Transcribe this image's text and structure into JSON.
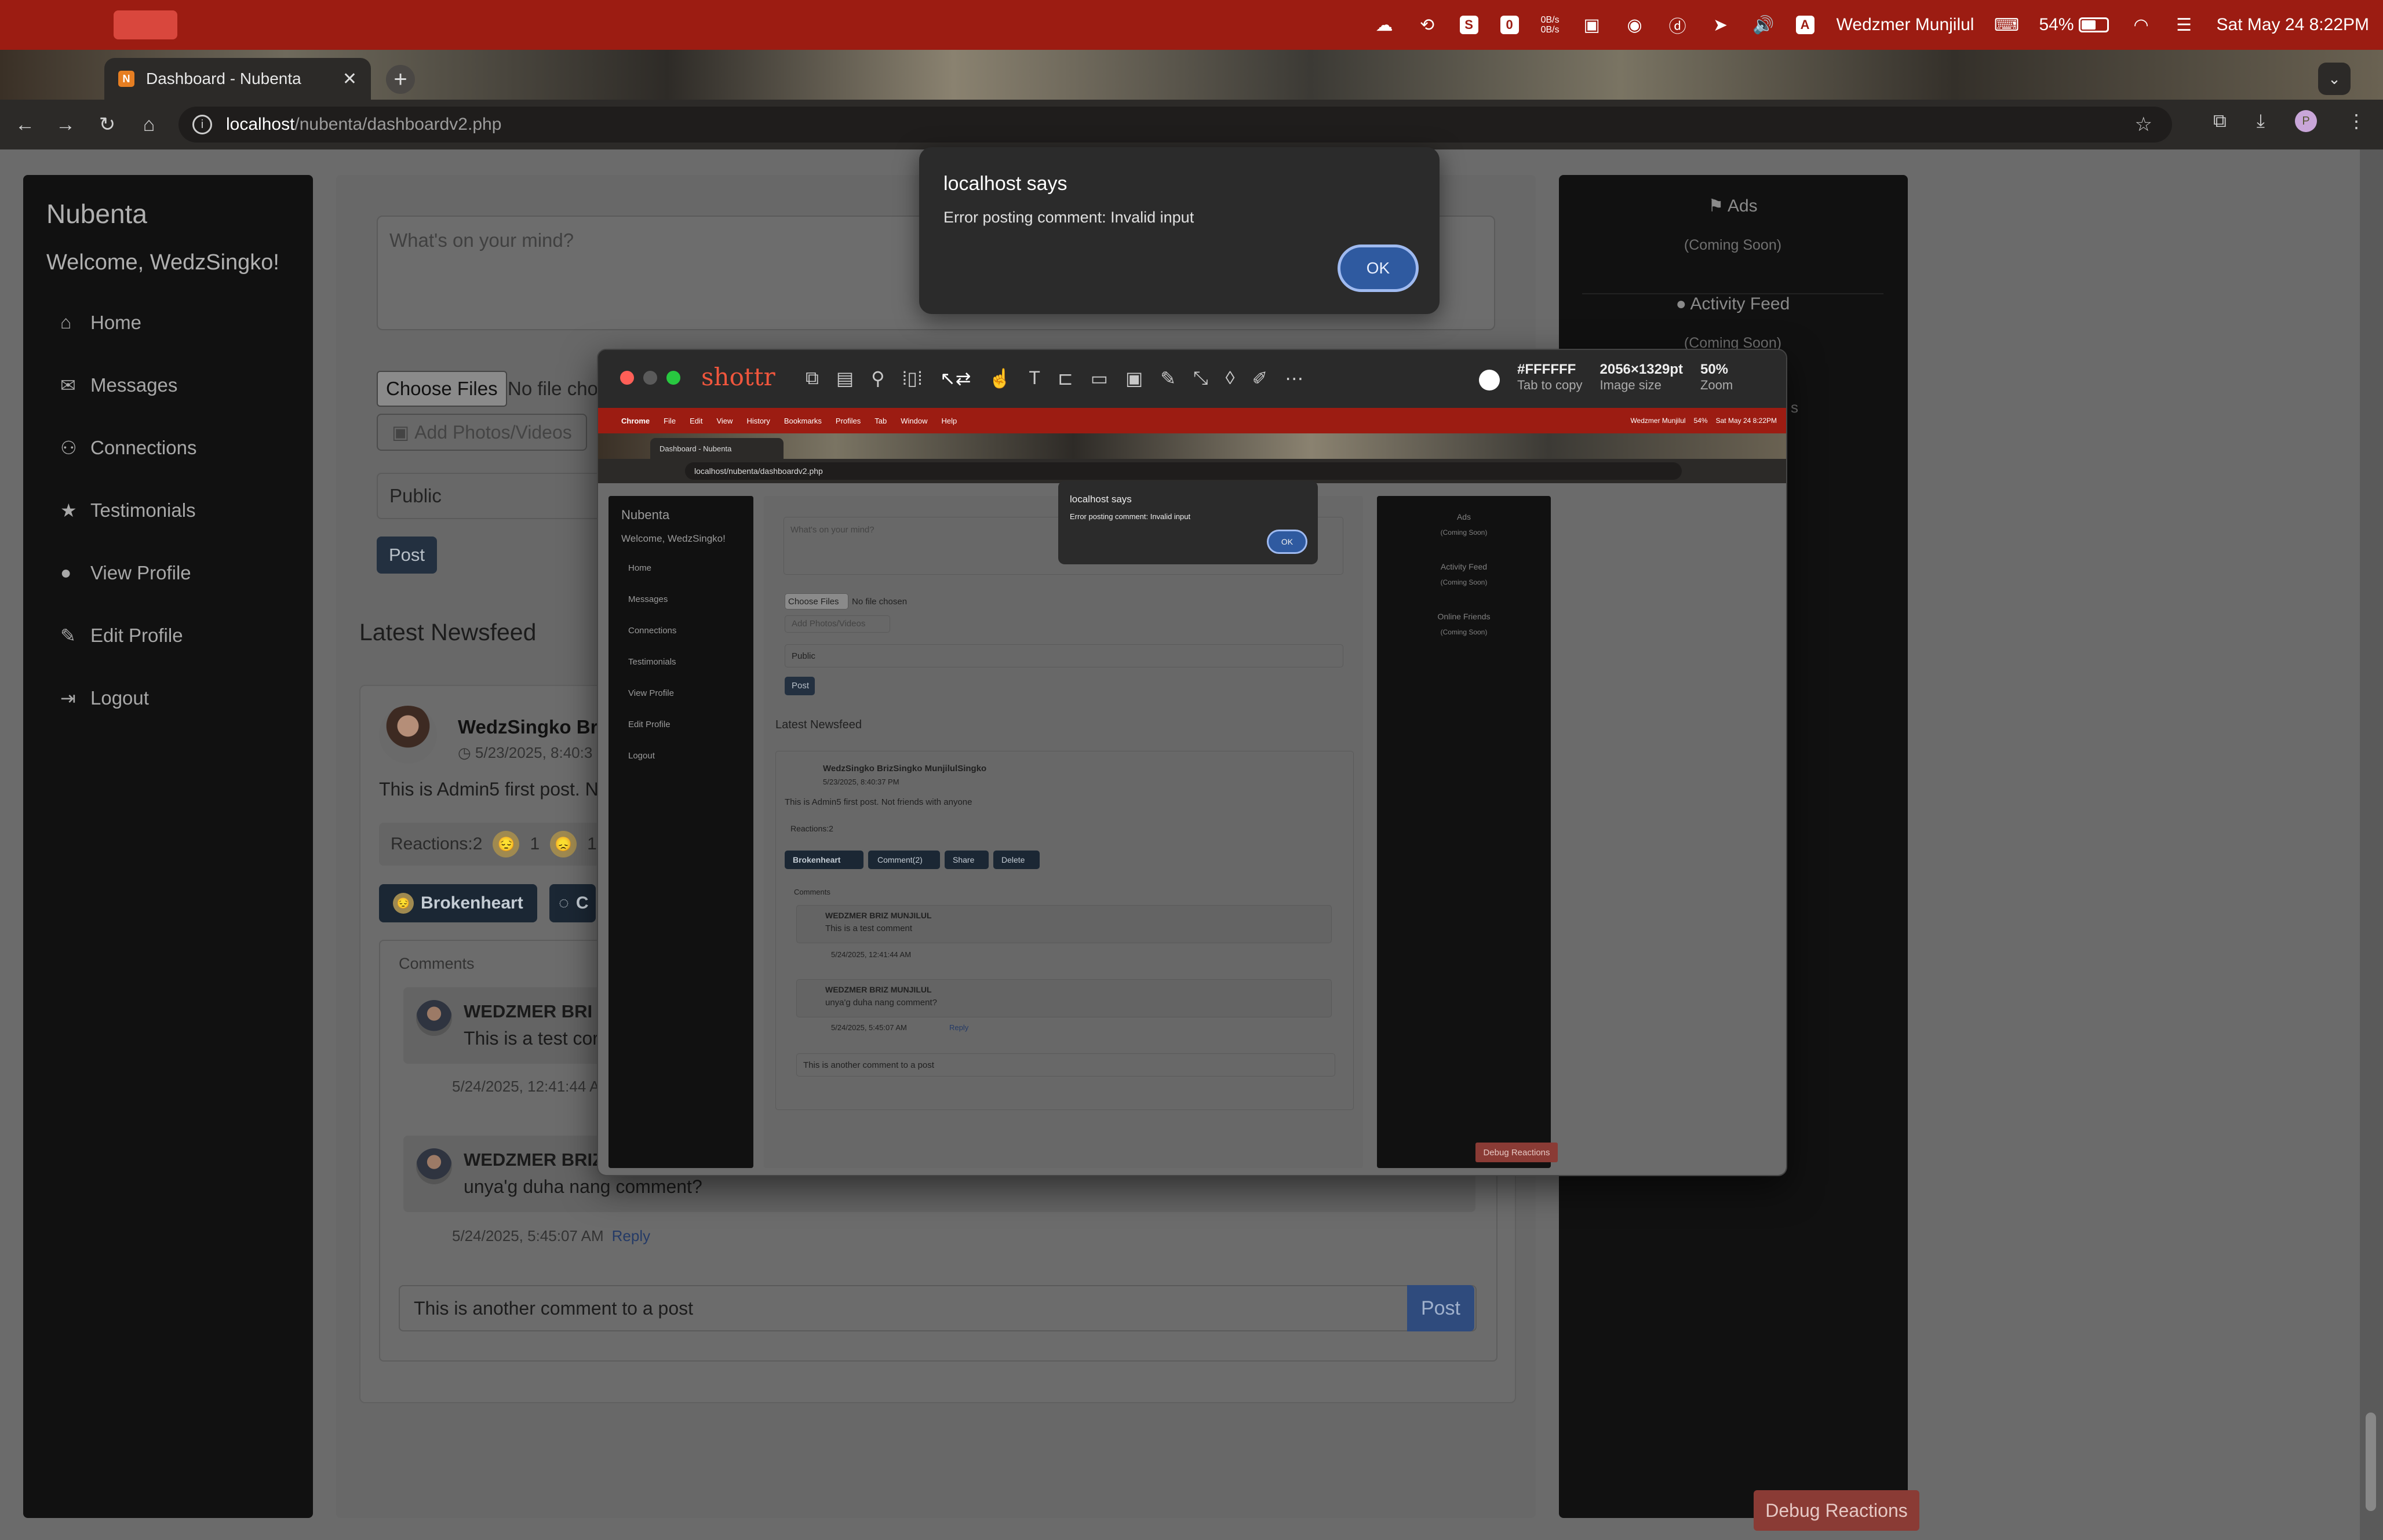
{
  "menubar": {
    "user_name": "Wedzmer Munjilul",
    "battery_percent": "54%",
    "datetime": "Sat May 24  8:22PM",
    "netspeed_up": "0B/s",
    "netspeed_down": "0B/s",
    "tray_icons": [
      "cloud-icon",
      "rotate-icon",
      "s-app-icon",
      "square-app-icon",
      "netspeed-icon",
      "dropbox-icon",
      "grammarly-icon",
      "d-app-icon",
      "cursor-icon",
      "volume-icon",
      "a-app-icon",
      "keyboard-icon",
      "battery-icon",
      "wifi-icon",
      "control-center-icon"
    ]
  },
  "browser": {
    "tab_title": "Dashboard - Nubenta",
    "url_host": "localhost",
    "url_path": "/nubenta/dashboardv2.php",
    "new_tab_label": "+",
    "profile_initial": "P"
  },
  "sidebar": {
    "brand": "Nubenta",
    "welcome": "Welcome, WedzSingko!",
    "items": [
      {
        "label": "Home",
        "icon": "home-icon"
      },
      {
        "label": "Messages",
        "icon": "envelope-icon"
      },
      {
        "label": "Connections",
        "icon": "users-icon"
      },
      {
        "label": "Testimonials",
        "icon": "star-icon"
      },
      {
        "label": "View Profile",
        "icon": "user-icon"
      },
      {
        "label": "Edit Profile",
        "icon": "user-edit-icon"
      },
      {
        "label": "Logout",
        "icon": "logout-icon"
      }
    ]
  },
  "composer": {
    "placeholder": "What's on your mind?",
    "choose_files": "Choose Files",
    "no_file": "No file cho",
    "add_media": "Add Photos/Videos",
    "privacy": "Public",
    "post": "Post"
  },
  "feed": {
    "title": "Latest Newsfeed",
    "post": {
      "author": "WedzSingko Bri",
      "date": "5/23/2025, 8:40:3",
      "body": "This is Admin5 first post. No",
      "reactions_label": "Reactions:2",
      "reaction_counts": [
        "1",
        "1"
      ],
      "btn_react": "Brokenheart",
      "btn_comment": "C",
      "comments_label": "Comments",
      "comments": [
        {
          "author": "WEDZMER BRI",
          "text": "This is a test cor",
          "meta": "5/24/2025, 12:41:44 A",
          "reply": ""
        },
        {
          "author": "WEDZMER BRIZ MUNJILUL",
          "text": "unya'g duha nang comment?",
          "meta": "5/24/2025, 5:45:07 AM",
          "reply": "Reply"
        }
      ],
      "comment_input": "This is another comment to a post",
      "comment_post": "Post"
    }
  },
  "right_panel": {
    "widgets": [
      {
        "title": "Ads",
        "sub": "(Coming Soon)"
      },
      {
        "title": "Activity Feed",
        "sub": "(Coming Soon)"
      }
    ],
    "partial_letter": "s"
  },
  "debug_button": "Debug Reactions",
  "alert": {
    "title": "localhost says",
    "message": "Error posting comment: Invalid input",
    "ok": "OK"
  },
  "shottr": {
    "brand": "shottr",
    "color_hex": "#FFFFFF",
    "color_hint": "Tab to copy",
    "image_size": "2056×1329pt",
    "image_size_label": "Image size",
    "zoom": "50%",
    "zoom_label": "Zoom",
    "tools": [
      "copy-icon",
      "save-icon",
      "pin-icon",
      "scroll-capture-icon",
      "select-icon",
      "hand-icon",
      "text-icon",
      "measure-icon",
      "rectangle-icon",
      "blur-icon",
      "pencil-icon",
      "resize-icon",
      "drop-icon",
      "highlighter-icon",
      "more-icon"
    ]
  },
  "mini": {
    "menu": [
      "Chrome",
      "File",
      "Edit",
      "View",
      "History",
      "Bookmarks",
      "Profiles",
      "Tab",
      "Window",
      "Help"
    ],
    "user": "Wedzmer Munjilul",
    "battery": "54%",
    "datetime": "Sat May 24  8:22PM",
    "tab_title": "Dashboard - Nubenta",
    "url": "localhost/nubenta/dashboardv2.php",
    "brand": "Nubenta",
    "welcome": "Welcome, WedzSingko!",
    "nav": [
      "Home",
      "Messages",
      "Connections",
      "Testimonials",
      "View Profile",
      "Edit Profile",
      "Logout"
    ],
    "composer_placeholder": "What's on your mind?",
    "choose_files": "Choose Files",
    "no_file": "No file chosen",
    "add_media": "Add Photos/Videos",
    "privacy": "Public",
    "post": "Post",
    "feed_title": "Latest Newsfeed",
    "author": "WedzSingko BrizSingko MunjilulSingko",
    "date": "5/23/2025, 8:40:37 PM",
    "body": "This is Admin5 first post. Not friends with anyone",
    "reactions": "Reactions:2",
    "btn_react": "Brokenheart",
    "btn_comment": "Comment(2)",
    "btn_share": "Share",
    "btn_delete": "Delete",
    "comments_label": "Comments",
    "c1_author": "WEDZMER BRIZ MUNJILUL",
    "c1_text": "This is a test comment",
    "c1_meta": "5/24/2025, 12:41:44 AM",
    "c2_author": "WEDZMER BRIZ MUNJILUL",
    "c2_text": "unya'g duha nang comment?",
    "c2_meta": "5/24/2025, 5:45:07 AM",
    "reply": "Reply",
    "comment_input": "This is another comment to a post",
    "right": [
      "Ads",
      "(Coming Soon)",
      "Activity Feed",
      "(Coming Soon)",
      "Online Friends",
      "(Coming Soon)"
    ],
    "alert_title": "localhost says",
    "alert_msg": "Error posting comment: Invalid input",
    "alert_ok": "OK",
    "debug": "Debug Reactions"
  }
}
